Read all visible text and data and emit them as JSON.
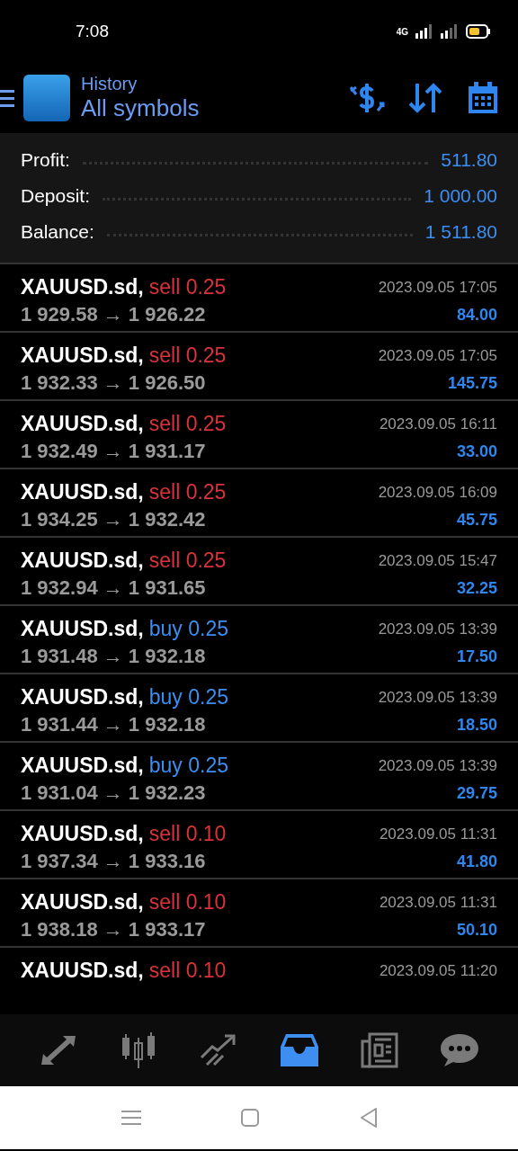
{
  "status_bar": {
    "time": "7:08",
    "network": "4G"
  },
  "header": {
    "title": "History",
    "subtitle": "All symbols"
  },
  "summary": [
    {
      "label": "Profit:",
      "value": "511.80"
    },
    {
      "label": "Deposit:",
      "value": "1 000.00"
    },
    {
      "label": "Balance:",
      "value": "1 511.80"
    }
  ],
  "deals": [
    {
      "symbol": "XAUUSD.sd,",
      "kind": "sell",
      "order": "sell 0.25",
      "prices": "1 929.58 → 1 926.22",
      "time": "2023.09.05 17:05",
      "profit": "84.00"
    },
    {
      "symbol": "XAUUSD.sd,",
      "kind": "sell",
      "order": "sell 0.25",
      "prices": "1 932.33 → 1 926.50",
      "time": "2023.09.05 17:05",
      "profit": "145.75"
    },
    {
      "symbol": "XAUUSD.sd,",
      "kind": "sell",
      "order": "sell 0.25",
      "prices": "1 932.49 → 1 931.17",
      "time": "2023.09.05 16:11",
      "profit": "33.00"
    },
    {
      "symbol": "XAUUSD.sd,",
      "kind": "sell",
      "order": "sell 0.25",
      "prices": "1 934.25 → 1 932.42",
      "time": "2023.09.05 16:09",
      "profit": "45.75"
    },
    {
      "symbol": "XAUUSD.sd,",
      "kind": "sell",
      "order": "sell 0.25",
      "prices": "1 932.94 → 1 931.65",
      "time": "2023.09.05 15:47",
      "profit": "32.25"
    },
    {
      "symbol": "XAUUSD.sd,",
      "kind": "buy",
      "order": "buy 0.25",
      "prices": "1 931.48 → 1 932.18",
      "time": "2023.09.05 13:39",
      "profit": "17.50"
    },
    {
      "symbol": "XAUUSD.sd,",
      "kind": "buy",
      "order": "buy 0.25",
      "prices": "1 931.44 → 1 932.18",
      "time": "2023.09.05 13:39",
      "profit": "18.50"
    },
    {
      "symbol": "XAUUSD.sd,",
      "kind": "buy",
      "order": "buy 0.25",
      "prices": "1 931.04 → 1 932.23",
      "time": "2023.09.05 13:39",
      "profit": "29.75"
    },
    {
      "symbol": "XAUUSD.sd,",
      "kind": "sell",
      "order": "sell 0.10",
      "prices": "1 937.34 → 1 933.16",
      "time": "2023.09.05 11:31",
      "profit": "41.80"
    },
    {
      "symbol": "XAUUSD.sd,",
      "kind": "sell",
      "order": "sell 0.10",
      "prices": "1 938.18 → 1 933.17",
      "time": "2023.09.05 11:31",
      "profit": "50.10"
    },
    {
      "symbol": "XAUUSD.sd,",
      "kind": "sell",
      "order": "sell 0.10",
      "time": "2023.09.05 11:20"
    }
  ],
  "bottom_nav": [
    {
      "kind": "quotes",
      "selected": false
    },
    {
      "kind": "chart",
      "selected": false
    },
    {
      "kind": "trade",
      "selected": false
    },
    {
      "kind": "history",
      "selected": true
    },
    {
      "kind": "news",
      "selected": false
    },
    {
      "kind": "chat",
      "selected": false
    }
  ]
}
